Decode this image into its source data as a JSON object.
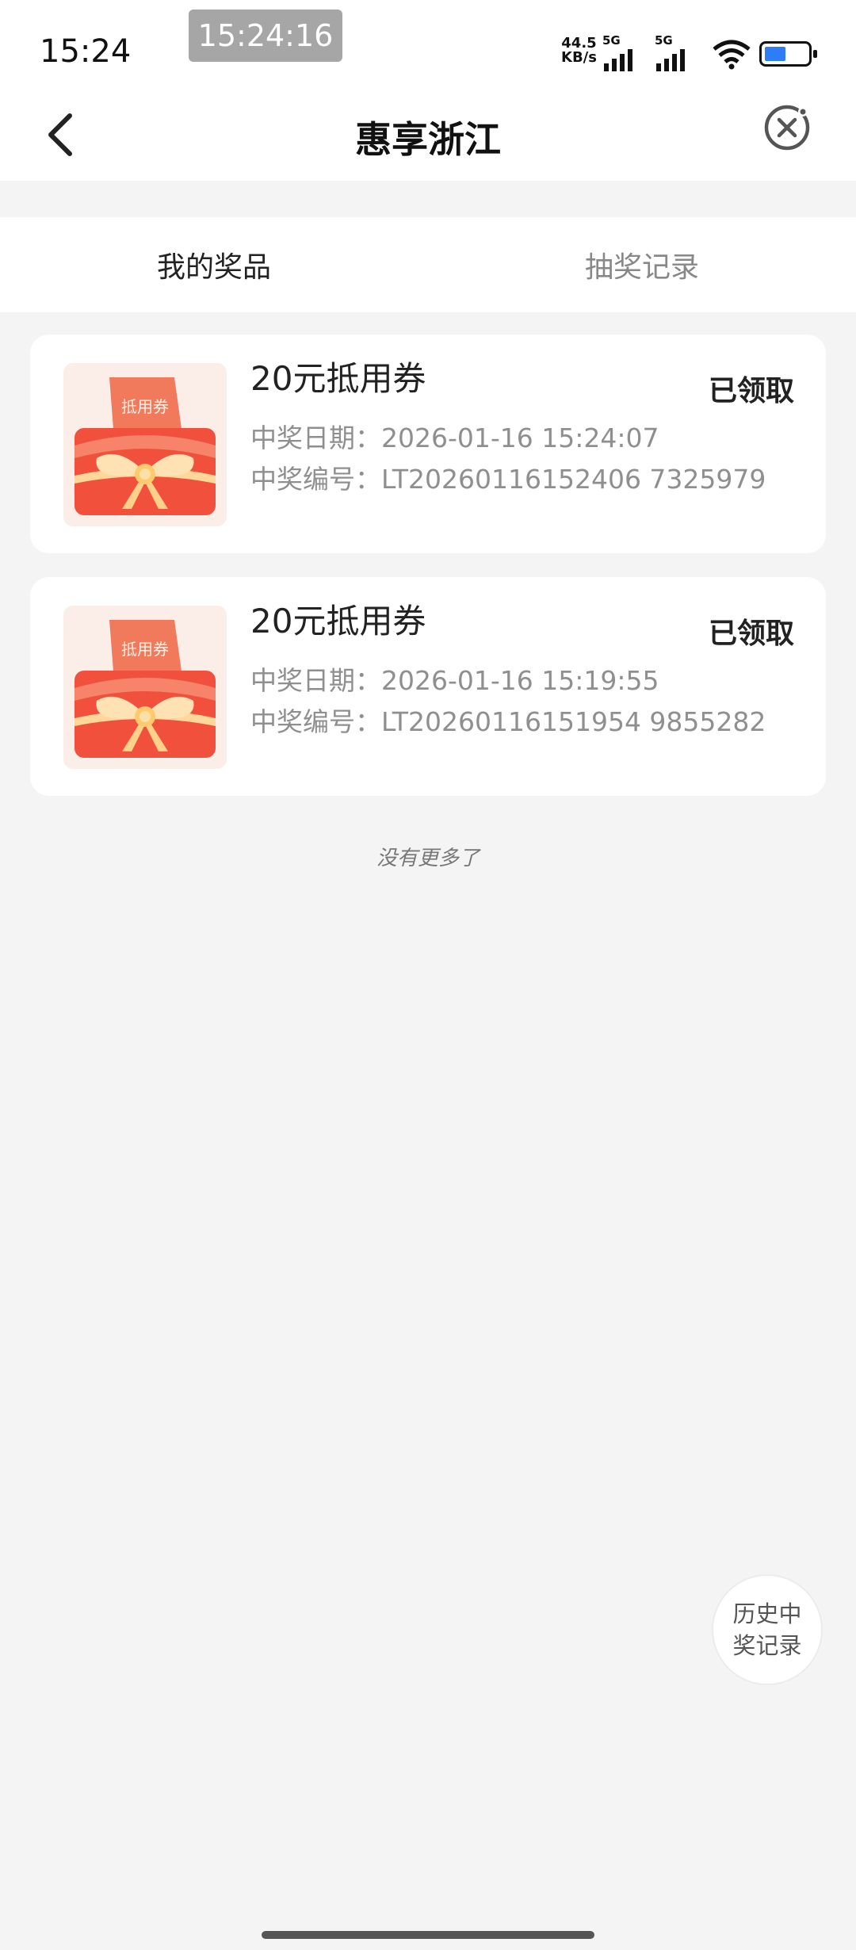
{
  "status_bar": {
    "time": "15:24",
    "overlay_clock": "15:24:16",
    "net_speed_value": "44.5",
    "net_speed_unit": "KB/s",
    "sim1_label": "5G",
    "sim2_label": "5G",
    "battery_icon": "battery-charging-icon",
    "wifi_icon": "wifi-icon"
  },
  "header": {
    "title": "惠享浙江",
    "back_icon": "chevron-left-icon",
    "close_icon": "close-circle-icon"
  },
  "tabs": [
    {
      "label": "我的奖品",
      "active": true
    },
    {
      "label": "抽奖记录",
      "active": false
    }
  ],
  "prizes": [
    {
      "name": "20元抵用券",
      "thumb_label": "抵用券",
      "date_label": "中奖日期：",
      "date": "2026-01-16 15:24:07",
      "code_label": "中奖编号：",
      "code": "LT20260116152406 7325979",
      "status": "已领取"
    },
    {
      "name": "20元抵用券",
      "thumb_label": "抵用券",
      "date_label": "中奖日期：",
      "date": "2026-01-16 15:19:55",
      "code_label": "中奖编号：",
      "code": "LT20260116151954 9855282",
      "status": "已领取"
    }
  ],
  "end_note": "没有更多了",
  "history_button": {
    "line1": "历史中",
    "line2": "奖记录"
  },
  "colors": {
    "background": "#f4f4f4",
    "card": "#ffffff",
    "coupon_red": "#f0503c",
    "ribbon_gold": "#ffd79a",
    "battery_fill": "#2e7cf6"
  }
}
